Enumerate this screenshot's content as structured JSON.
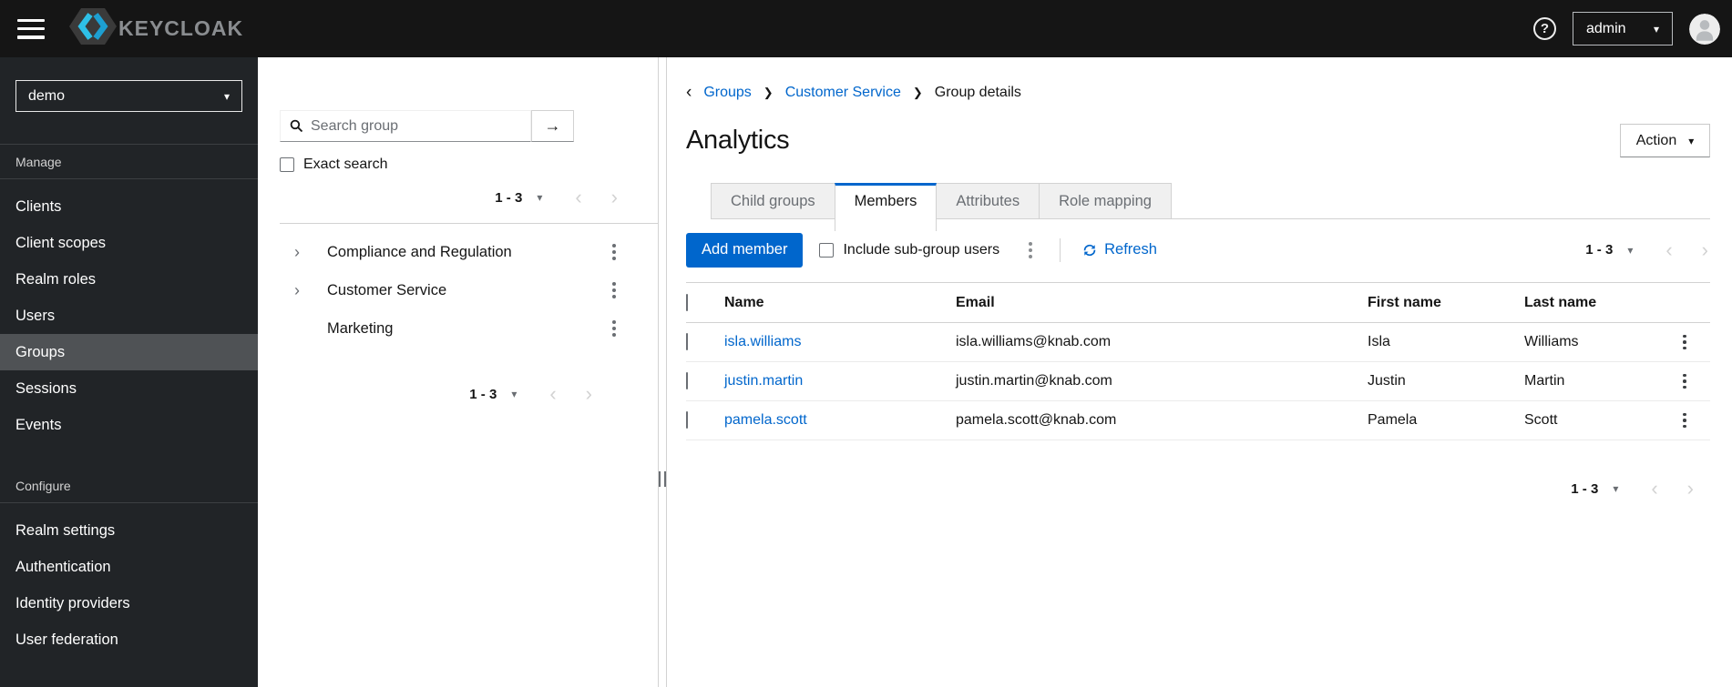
{
  "masthead": {
    "brand": "KEYCLOAK",
    "user": "admin"
  },
  "sidebar": {
    "realm": "demo",
    "selected_item": "Groups",
    "sections": [
      {
        "label": "Manage",
        "items": [
          "Clients",
          "Client scopes",
          "Realm roles",
          "Users",
          "Groups",
          "Sessions",
          "Events"
        ]
      },
      {
        "label": "Configure",
        "items": [
          "Realm settings",
          "Authentication",
          "Identity providers",
          "User federation"
        ]
      }
    ]
  },
  "tree": {
    "search_placeholder": "Search group",
    "search_value": "",
    "exact_label": "Exact search",
    "top_pagination": "1 - 3",
    "bottom_pagination": "1 - 3",
    "groups": [
      {
        "name": "Compliance and Regulation",
        "expandable": true
      },
      {
        "name": "Customer Service",
        "expandable": true
      },
      {
        "name": "Marketing",
        "expandable": false
      }
    ]
  },
  "main": {
    "breadcrumb": [
      "Groups",
      "Customer Service",
      "Group details"
    ],
    "title": "Analytics",
    "action_label": "Action",
    "tabs": [
      "Child groups",
      "Members",
      "Attributes",
      "Role mapping"
    ],
    "active_tab": "Members",
    "toolbar": {
      "add_member": "Add member",
      "include_label": "Include sub-group users",
      "refresh": "Refresh",
      "pagination": "1 - 3"
    },
    "table": {
      "columns": [
        "Name",
        "Email",
        "First name",
        "Last name"
      ],
      "rows": [
        {
          "name": "isla.williams",
          "email": "isla.williams@knab.com",
          "first": "Isla",
          "last": "Williams"
        },
        {
          "name": "justin.martin",
          "email": "justin.martin@knab.com",
          "first": "Justin",
          "last": "Martin"
        },
        {
          "name": "pamela.scott",
          "email": "pamela.scott@knab.com",
          "first": "Pamela",
          "last": "Scott"
        }
      ]
    },
    "bottom_pagination": "1 - 3"
  },
  "colors": {
    "accent": "#0066cc",
    "link": "#0066cc",
    "masthead_bg": "#151515",
    "sidebar_bg": "#212427",
    "selected_nav_bg": "#4f5255",
    "tab_inactive_bg": "#f0f0f0"
  }
}
